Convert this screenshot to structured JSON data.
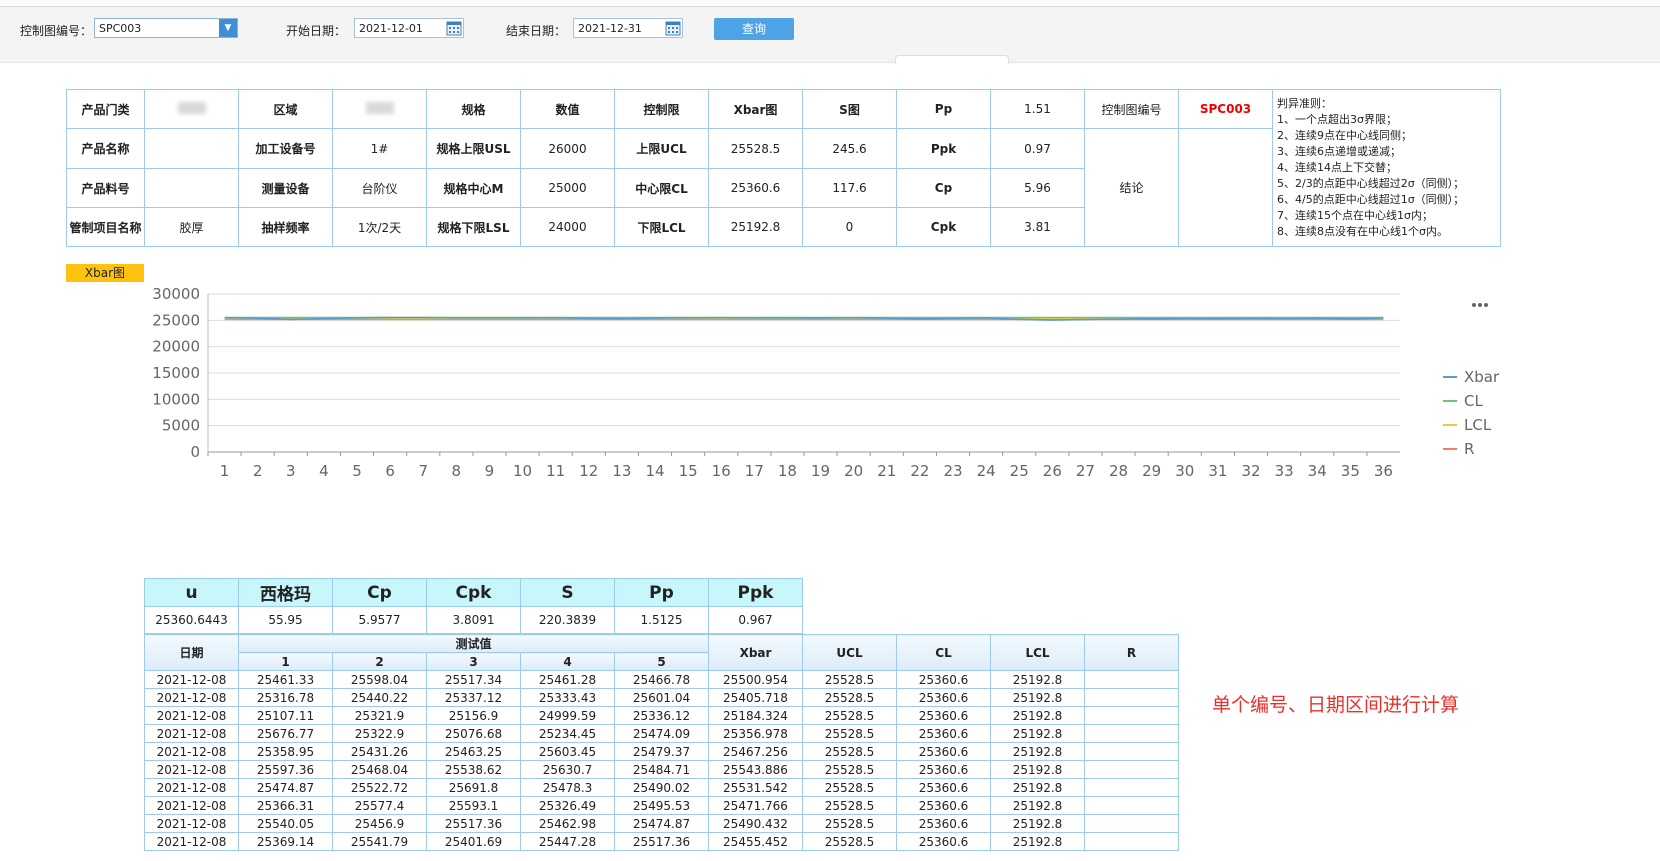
{
  "toolbar": {
    "control_chart_label": "控制图编号：",
    "control_chart_value": "SPC003",
    "start_label": "开始日期：",
    "start_value": "2021-12-01",
    "end_label": "结束日期：",
    "end_value": "2021-12-31",
    "query_label": "查询"
  },
  "summary": {
    "product_category_label": "产品门类",
    "region_label": "区域",
    "spec_label": "规格",
    "value_label": "数值",
    "control_limit_label": "控制限",
    "xbar_label": "Xbar图",
    "s_label": "S图",
    "pp_label": "Pp",
    "pp_value": "1.51",
    "chart_no_label": "控制图编号",
    "chart_no_value": "SPC003",
    "rules": {
      "title": "判异准则：",
      "items": [
        "1、一个点超出3σ界限；",
        "2、连续9点在中心线同侧；",
        "3、连续6点递增或递减；",
        "4、连续14点上下交替；",
        "5、2/3的点距中心线超过2σ（同侧）；",
        "6、4/5的点距中心线超过1σ（同侧）；",
        "7、连续15个点在中心线1σ内；",
        "8、连续8点没有在中心线1个σ内。"
      ]
    },
    "product_name_label": "产品名称",
    "equipment_label": "加工设备号",
    "equipment_value": "1#",
    "usl_label": "规格上限USL",
    "usl_value": "26000",
    "ucl_label": "上限UCL",
    "ucl_xbar": "25528.5",
    "ucl_s": "245.6",
    "ppk_label": "Ppk",
    "ppk_value": "0.97",
    "conclusion_label": "结论",
    "part_no_label": "产品料号",
    "measure_device_label": "测量设备",
    "measure_device_value": "台阶仪",
    "m_label": "规格中心M",
    "m_value": "25000",
    "cl_label": "中心限CL",
    "cl_xbar": "25360.6",
    "cl_s": "117.6",
    "cp_label": "Cp",
    "cp_value": "5.96",
    "item_name_label": "管制项目名称",
    "item_name_value": "胶厚",
    "freq_label": "抽样频率",
    "freq_value": "1次/2天",
    "lsl_label": "规格下限LSL",
    "lsl_value": "24000",
    "lcl_label": "下限LCL",
    "lcl_xbar": "25192.8",
    "lcl_s": "0",
    "cpk_label": "Cpk",
    "cpk_value": "3.81"
  },
  "chart_tag": "Xbar图",
  "chart_menu_icon": "more-dots-icon",
  "chart_data": {
    "type": "line",
    "x": [
      1,
      2,
      3,
      4,
      5,
      6,
      7,
      8,
      9,
      10,
      11,
      12,
      13,
      14,
      15,
      16,
      17,
      18,
      19,
      20,
      21,
      22,
      23,
      24,
      25,
      26,
      27,
      28,
      29,
      30,
      31,
      32,
      33,
      34,
      35,
      36
    ],
    "ylim": [
      0,
      30000
    ],
    "yticks": [
      0,
      5000,
      10000,
      15000,
      20000,
      25000,
      30000
    ],
    "grid": true,
    "legend_position": "right",
    "series": [
      {
        "name": "Xbar",
        "color": "#5b9bd5",
        "values": [
          25500,
          25406,
          25184,
          25357,
          25467,
          25544,
          25532,
          25472,
          25490,
          25455,
          25472,
          25380,
          25330,
          25420,
          25480,
          25500,
          25450,
          25470,
          25430,
          25480,
          25400,
          25300,
          25380,
          25450,
          25200,
          25050,
          25150,
          25250,
          25300,
          25350,
          25320,
          25380,
          25350,
          25400,
          25300,
          25450
        ]
      },
      {
        "name": "CL",
        "color": "#70c66f",
        "values": [
          25528.5,
          25528.5,
          25528.5,
          25528.5,
          25528.5,
          25528.5,
          25528.5,
          25528.5,
          25528.5,
          25528.5,
          25528.5,
          25528.5,
          25528.5,
          25528.5,
          25528.5,
          25528.5,
          25528.5,
          25528.5,
          25528.5,
          25528.5,
          25528.5,
          25528.5,
          25528.5,
          25528.5,
          25528.5,
          25528.5,
          25528.5,
          25528.5,
          25528.5,
          25528.5,
          25528.5,
          25528.5,
          25528.5,
          25528.5,
          25528.5,
          25528.5
        ]
      },
      {
        "name": "LCL",
        "color": "#f5c542",
        "values": [
          25360.6,
          25360.6,
          25360.6,
          25360.6,
          25360.6,
          25360.6,
          25360.6,
          25360.6,
          25360.6,
          25360.6,
          25360.6,
          25360.6,
          25360.6,
          25360.6,
          25360.6,
          25360.6,
          25360.6,
          25360.6,
          25360.6,
          25360.6,
          25360.6,
          25360.6,
          25360.6,
          25360.6,
          25360.6,
          25360.6,
          25360.6,
          25360.6,
          25360.6,
          25360.6,
          25360.6,
          25360.6,
          25360.6,
          25360.6,
          25360.6,
          25360.6
        ]
      },
      {
        "name": "R",
        "color": "#f08060",
        "values": [
          25192.8,
          25192.8,
          25192.8,
          25192.8,
          25192.8,
          25192.8,
          25192.8,
          25192.8,
          25192.8,
          25192.8,
          25192.8,
          25192.8,
          25192.8,
          25192.8,
          25192.8,
          25192.8,
          25192.8,
          25192.8,
          25192.8,
          25192.8,
          25192.8,
          25192.8,
          25192.8,
          25192.8,
          25192.8,
          25192.8,
          25192.8,
          25192.8,
          25192.8,
          25192.8,
          25192.8,
          25192.8,
          25192.8,
          25192.8,
          25192.8,
          25192.8
        ]
      }
    ]
  },
  "stats": {
    "headers": [
      "u",
      "西格玛",
      "Cp",
      "Cpk",
      "S",
      "Pp",
      "Ppk"
    ],
    "values": [
      "25360.6443",
      "55.95",
      "5.9577",
      "3.8091",
      "220.3839",
      "1.5125",
      "0.967"
    ]
  },
  "data_table": {
    "date_header": "日期",
    "test_group_header": "测试值",
    "sub_headers": [
      "1",
      "2",
      "3",
      "4",
      "5"
    ],
    "xbar_header": "Xbar",
    "ucl_header": "UCL",
    "cl_header": "CL",
    "lcl_header": "LCL",
    "r_header": "R",
    "rows": [
      [
        "2021-12-08",
        "25461.33",
        "25598.04",
        "25517.34",
        "25461.28",
        "25466.78",
        "25500.954",
        "25528.5",
        "25360.6",
        "25192.8",
        ""
      ],
      [
        "2021-12-08",
        "25316.78",
        "25440.22",
        "25337.12",
        "25333.43",
        "25601.04",
        "25405.718",
        "25528.5",
        "25360.6",
        "25192.8",
        ""
      ],
      [
        "2021-12-08",
        "25107.11",
        "25321.9",
        "25156.9",
        "24999.59",
        "25336.12",
        "25184.324",
        "25528.5",
        "25360.6",
        "25192.8",
        ""
      ],
      [
        "2021-12-08",
        "25676.77",
        "25322.9",
        "25076.68",
        "25234.45",
        "25474.09",
        "25356.978",
        "25528.5",
        "25360.6",
        "25192.8",
        ""
      ],
      [
        "2021-12-08",
        "25358.95",
        "25431.26",
        "25463.25",
        "25603.45",
        "25479.37",
        "25467.256",
        "25528.5",
        "25360.6",
        "25192.8",
        ""
      ],
      [
        "2021-12-08",
        "25597.36",
        "25468.04",
        "25538.62",
        "25630.7",
        "25484.71",
        "25543.886",
        "25528.5",
        "25360.6",
        "25192.8",
        ""
      ],
      [
        "2021-12-08",
        "25474.87",
        "25522.72",
        "25691.8",
        "25478.3",
        "25490.02",
        "25531.542",
        "25528.5",
        "25360.6",
        "25192.8",
        ""
      ],
      [
        "2021-12-08",
        "25366.31",
        "25577.4",
        "25593.1",
        "25326.49",
        "25495.53",
        "25471.766",
        "25528.5",
        "25360.6",
        "25192.8",
        ""
      ],
      [
        "2021-12-08",
        "25540.05",
        "25456.9",
        "25517.36",
        "25462.98",
        "25474.87",
        "25490.432",
        "25528.5",
        "25360.6",
        "25192.8",
        ""
      ],
      [
        "2021-12-08",
        "25369.14",
        "25541.79",
        "25401.69",
        "25447.28",
        "25517.36",
        "25455.452",
        "25528.5",
        "25360.6",
        "25192.8",
        ""
      ]
    ]
  },
  "note": "单个编号、日期区间进行计算"
}
